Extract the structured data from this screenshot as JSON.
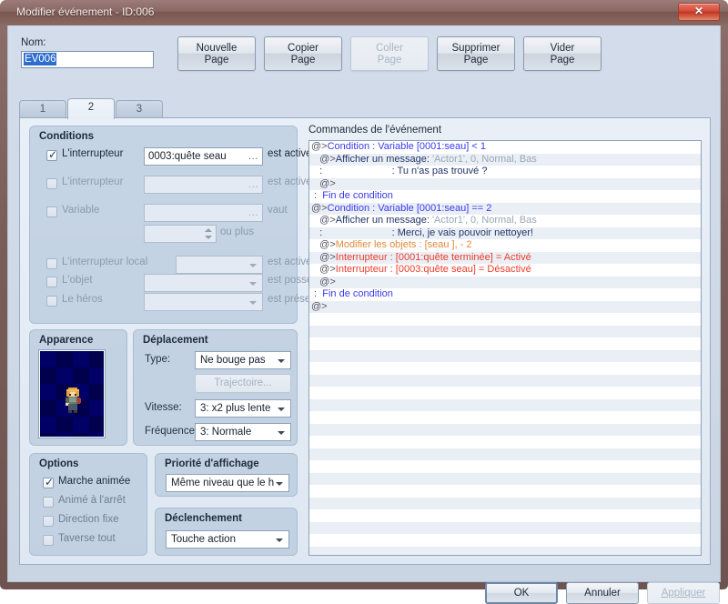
{
  "window": {
    "title": "Modifier événement - ID:006",
    "close_label": "✕"
  },
  "header": {
    "nom_label": "Nom:",
    "nom_value": "EV006",
    "buttons": [
      {
        "line1": "Nouvelle",
        "line2": "Page",
        "enabled": true
      },
      {
        "line1": "Copier",
        "line2": "Page",
        "enabled": true
      },
      {
        "line1": "Coller",
        "line2": "Page",
        "enabled": false
      },
      {
        "line1": "Supprimer",
        "line2": "Page",
        "enabled": true
      },
      {
        "line1": "Vider",
        "line2": "Page",
        "enabled": true
      }
    ]
  },
  "tabs": [
    {
      "label": "1",
      "active": false
    },
    {
      "label": "2",
      "active": true
    },
    {
      "label": "3",
      "active": false
    }
  ],
  "conditions": {
    "title": "Conditions",
    "rows": [
      {
        "label": "L'interrupteur",
        "checked": true,
        "value": "0003:quête seau",
        "suffix": "est activé",
        "ellipsis": "..."
      },
      {
        "label": "L'interrupteur",
        "checked": false,
        "value": "",
        "suffix": "est activé",
        "ellipsis": "..."
      },
      {
        "label": "Variable",
        "checked": false,
        "value": "",
        "suffix": "vaut",
        "ellipsis": "..."
      },
      {
        "label": "",
        "checked": null,
        "value": "",
        "suffix": "ou plus",
        "ellipsis": ""
      },
      {
        "label": "L'interrupteur local",
        "checked": false,
        "value": "",
        "suffix": "est activé",
        "ellipsis": ""
      },
      {
        "label": "L'objet",
        "checked": false,
        "value": "",
        "suffix": "est possédé",
        "ellipsis": ""
      },
      {
        "label": "Le héros",
        "checked": false,
        "value": "",
        "suffix": "est présent",
        "ellipsis": ""
      }
    ]
  },
  "apparence": {
    "title": "Apparence"
  },
  "deplacement": {
    "title": "Déplacement",
    "type_label": "Type:",
    "type_value": "Ne bouge pas",
    "trajectoire_label": "Trajectoire...",
    "vitesse_label": "Vitesse:",
    "vitesse_value": "3: x2 plus lente",
    "frequence_label": "Fréquence:",
    "frequence_value": "3: Normale"
  },
  "options": {
    "title": "Options",
    "items": [
      {
        "label": "Marche animée",
        "checked": true
      },
      {
        "label": "Animé à l'arrêt",
        "checked": false
      },
      {
        "label": "Direction fixe",
        "checked": false
      },
      {
        "label": "Taverse tout",
        "checked": false
      }
    ]
  },
  "priorite": {
    "title": "Priorité d'affichage",
    "value": "Même niveau que le h"
  },
  "declenchement": {
    "title": "Déclenchement",
    "value": "Touche action"
  },
  "commands": {
    "title": "Commandes de l'événement",
    "rows": [
      {
        "alt": false,
        "segments": [
          {
            "t": "@>",
            "c": "at"
          },
          {
            "t": "Condition : Variable [0001:seau] < 1",
            "c": "blue"
          }
        ]
      },
      {
        "alt": true,
        "segments": [
          {
            "t": "   @>",
            "c": "at"
          },
          {
            "t": "Afficher un message: ",
            "c": "dark"
          },
          {
            "t": "'Actor1', 0, Normal, Bas",
            "c": "gray"
          }
        ]
      },
      {
        "alt": false,
        "segments": [
          {
            "t": "   :                         : Tu n'as pas trouvé ?",
            "c": "dark"
          }
        ]
      },
      {
        "alt": true,
        "segments": [
          {
            "t": "   @>",
            "c": "at"
          }
        ]
      },
      {
        "alt": false,
        "segments": [
          {
            "t": " :  ",
            "c": "blue"
          },
          {
            "t": "Fin de condition",
            "c": "blue"
          }
        ]
      },
      {
        "alt": true,
        "segments": [
          {
            "t": "@>",
            "c": "at"
          },
          {
            "t": "Condition : Variable [0001:seau] == 2",
            "c": "blue"
          }
        ]
      },
      {
        "alt": false,
        "segments": [
          {
            "t": "   @>",
            "c": "at"
          },
          {
            "t": "Afficher un message: ",
            "c": "dark"
          },
          {
            "t": "'Actor1', 0, Normal, Bas",
            "c": "gray"
          }
        ]
      },
      {
        "alt": true,
        "segments": [
          {
            "t": "   :                         : Merci, je vais pouvoir nettoyer!",
            "c": "dark"
          }
        ]
      },
      {
        "alt": false,
        "segments": [
          {
            "t": "   @>",
            "c": "at"
          },
          {
            "t": "Modifier les objets : [seau ], - 2",
            "c": "orange"
          }
        ]
      },
      {
        "alt": true,
        "segments": [
          {
            "t": "   @>",
            "c": "at"
          },
          {
            "t": "Interrupteur : [0001:quête terminée] = Activé",
            "c": "red"
          }
        ]
      },
      {
        "alt": false,
        "segments": [
          {
            "t": "   @>",
            "c": "at"
          },
          {
            "t": "Interrupteur : [0003:quête seau] = Désactivé",
            "c": "red"
          }
        ]
      },
      {
        "alt": true,
        "segments": [
          {
            "t": "   @>",
            "c": "at"
          }
        ]
      },
      {
        "alt": false,
        "segments": [
          {
            "t": " :  ",
            "c": "blue"
          },
          {
            "t": "Fin de condition",
            "c": "blue"
          }
        ]
      },
      {
        "alt": true,
        "segments": [
          {
            "t": "@>",
            "c": "at"
          }
        ]
      }
    ],
    "empty_rows": 20
  },
  "footer": {
    "ok": "OK",
    "cancel": "Annuler",
    "apply": "Appliquer"
  },
  "colors": {
    "titlebar": "#8a6863",
    "client_bg": "#ccd6e3",
    "accent_blue": "#3a3af0",
    "command_red": "#ee3b2b",
    "command_orange": "#e08a3c"
  }
}
